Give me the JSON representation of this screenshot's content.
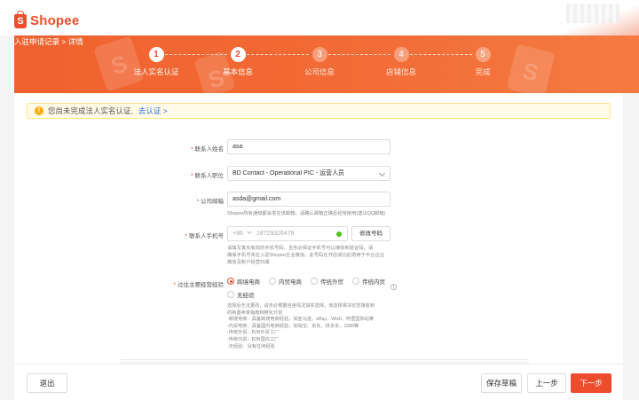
{
  "app": {
    "brand": "Shopee"
  },
  "breadcrumb": "入驻申请记录 > 详情",
  "steps": [
    {
      "number": "1",
      "label": "法人实名认证",
      "state": "active"
    },
    {
      "number": "2",
      "label": "基本信息",
      "state": "active"
    },
    {
      "number": "3",
      "label": "公司信息",
      "state": "pending"
    },
    {
      "number": "4",
      "label": "店铺信息",
      "state": "pending"
    },
    {
      "number": "5",
      "label": "完成",
      "state": "pending"
    }
  ],
  "notice": {
    "text": "您尚未完成法人实名认证,",
    "link": "去认证 >",
    "icon": "warning-icon"
  },
  "form": {
    "contact_name": {
      "label": "联系人姓名",
      "value": "asa"
    },
    "contact_position": {
      "label": "联系人职位",
      "value": "BD Contact - Operational PIC - 运营人员"
    },
    "company_email": {
      "label": "公司邮箱",
      "value": "asda@gmail.com",
      "hint": "Shopee所有通知都会发往该邮箱，请确认邮箱正确且经常使用(建议QQ邮箱)"
    },
    "contact_phone": {
      "label": "联系人手机号",
      "prefix": "+86",
      "value": "18729326478",
      "edit_button": "修改号码",
      "hint": [
        "请填写真实有效的手机号码，且务必保证手机号可以接收到验证码；请",
        "确保手机号未在入驻Shopee企业微信，此号码在开店成功后将用于平台企业",
        "微信及账户经营归属"
      ]
    },
    "experience": {
      "label": "过往主要经营经验",
      "options": [
        {
          "label": "跨境电商",
          "checked": true
        },
        {
          "label": "内贸电商",
          "checked": false
        },
        {
          "label": "传统外贸",
          "checked": false
        },
        {
          "label": "传统内贸",
          "checked": false
        },
        {
          "label": "无经验",
          "checked": false
        }
      ],
      "description": [
        "选择后无法更改，请务必根据自身情况如实选择，该选择将决定您接收到",
        "的新晋卖家指南和孵化计划",
        "-跨境电商：具备跨境电商经验，如亚马逊、eBay、Wish、阿里国际站等",
        "-内贸电商：具备国内电商经验，如淘宝、京东、拼多多、1688等",
        "-传统外贸：B2B外贸工厂",
        "-传统内贸：B2B国内工厂",
        "-无经验：没有任何经验"
      ]
    }
  },
  "footer": {
    "exit": "退出",
    "save_draft": "保存草稿",
    "prev": "上一步",
    "next": "下一步"
  },
  "colors": {
    "brand": "#ee4d2d",
    "link": "#2673dd",
    "success": "#52c41a"
  }
}
